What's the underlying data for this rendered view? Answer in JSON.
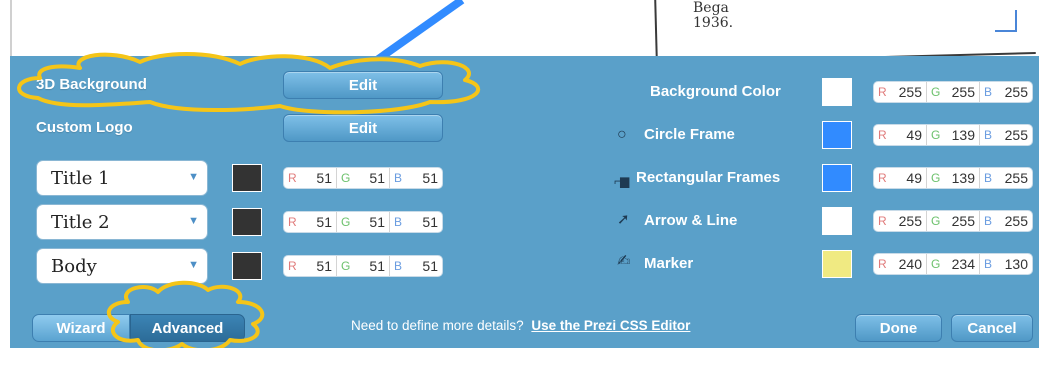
{
  "canvas": {
    "text": "Bega\n1936."
  },
  "left": {
    "rows": [
      {
        "label": "3D Background",
        "button": "Edit"
      },
      {
        "label": "Custom Logo",
        "button": "Edit"
      }
    ],
    "styles": [
      {
        "name": "Title 1",
        "swatch": "#333333",
        "r": "51",
        "g": "51",
        "b": "51"
      },
      {
        "name": "Title 2",
        "swatch": "#333333",
        "r": "51",
        "g": "51",
        "b": "51"
      },
      {
        "name": "Body",
        "swatch": "#333333",
        "r": "51",
        "g": "51",
        "b": "51"
      }
    ]
  },
  "right": {
    "items": [
      {
        "label": "Background Color",
        "icon": "",
        "swatch": "#ffffff",
        "r": "255",
        "g": "255",
        "b": "255"
      },
      {
        "label": "Circle Frame",
        "icon": "circle-icon",
        "swatch": "#318bff",
        "r": "49",
        "g": "139",
        "b": "255"
      },
      {
        "label": "Rectangular Frames",
        "icon": "rectangle-frame-icon",
        "swatch": "#318bff",
        "r": "49",
        "g": "139",
        "b": "255"
      },
      {
        "label": "Arrow & Line",
        "icon": "arrow-icon",
        "swatch": "#ffffff",
        "r": "255",
        "g": "255",
        "b": "255"
      },
      {
        "label": "Marker",
        "icon": "marker-icon",
        "swatch": "#f0ea82",
        "r": "240",
        "g": "234",
        "b": "130"
      }
    ],
    "channels": {
      "r": "R",
      "g": "G",
      "b": "B"
    }
  },
  "footer": {
    "tabs": {
      "wizard": "Wizard",
      "advanced": "Advanced"
    },
    "help_text": "Need to define more details?",
    "help_link": "Use the Prezi CSS Editor",
    "done": "Done",
    "cancel": "Cancel"
  },
  "colors": {
    "panel": "#5aa0c9",
    "annotation": "#f5c518"
  }
}
